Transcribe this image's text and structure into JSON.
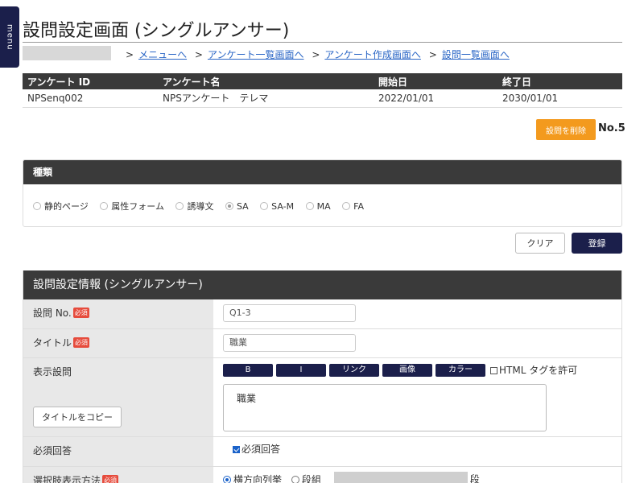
{
  "menu_label": "menu",
  "page_title": "設問設定画面 (シングルアンサー)",
  "breadcrumb": {
    "separator": ">",
    "links": [
      "メニューへ",
      "アンケート一覧画面へ",
      "アンケート作成画面へ",
      "設問一覧画面へ"
    ]
  },
  "survey_table": {
    "headers": [
      "アンケート ID",
      "アンケート名",
      "開始日",
      "終了日"
    ],
    "row": [
      "NPSenq002",
      "NPSアンケート　テレマ",
      "2022/01/01",
      "2030/01/01"
    ]
  },
  "delete_button": "設問を削除",
  "question_number": "No.5",
  "type_panel": {
    "title": "種類",
    "options": [
      "静的ページ",
      "属性フォーム",
      "誘導文",
      "SA",
      "SA-M",
      "MA",
      "FA"
    ],
    "selected": "SA"
  },
  "actions": {
    "clear": "クリア",
    "save": "登録"
  },
  "info_panel": {
    "title": "設問設定情報 (シングルアンサー)",
    "required_badge": "必須",
    "question_no": {
      "label": "設問 No.",
      "value": "Q1-3"
    },
    "title_field": {
      "label": "タイトル",
      "value": "職業"
    },
    "display_question": {
      "label": "表示設問",
      "toolbar": [
        "B",
        "I",
        "リンク",
        "画像",
        "カラー"
      ],
      "allow_html_label": "HTML タグを許可",
      "text": "職業",
      "copy_title_button": "タイトルをコピー"
    },
    "required_answer": {
      "label": "必須回答",
      "checkbox_label": "必須回答"
    },
    "choice_display": {
      "label": "選択肢表示方法",
      "options": [
        "横方向列挙",
        "段組"
      ],
      "suffix": "段"
    }
  },
  "colors": {
    "dark_header": "#3a3a3a",
    "navy": "#1b1f4b",
    "orange": "#f39a1e",
    "link": "#2a66c6",
    "required": "#e64b3c"
  }
}
